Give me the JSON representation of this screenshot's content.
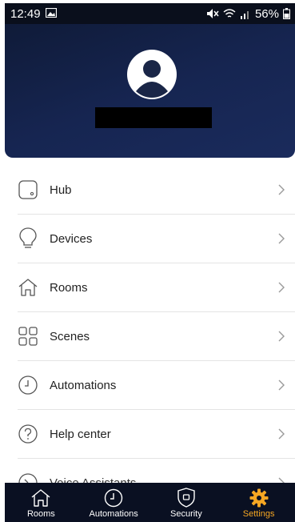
{
  "status_bar": {
    "time": "12:49",
    "battery": "56%"
  },
  "menu": {
    "items": [
      {
        "label": "Hub",
        "icon": "hub-icon"
      },
      {
        "label": "Devices",
        "icon": "lightbulb-icon"
      },
      {
        "label": "Rooms",
        "icon": "house-icon"
      },
      {
        "label": "Scenes",
        "icon": "scenes-grid-icon"
      },
      {
        "label": "Automations",
        "icon": "clock-icon"
      },
      {
        "label": "Help center",
        "icon": "question-icon"
      },
      {
        "label": "Voice Assistants",
        "icon": "voice-icon"
      }
    ]
  },
  "bottom_nav": {
    "items": [
      {
        "label": "Rooms",
        "icon": "house-icon"
      },
      {
        "label": "Automations",
        "icon": "clock-icon"
      },
      {
        "label": "Security",
        "icon": "shield-icon"
      },
      {
        "label": "Settings",
        "icon": "gear-icon",
        "active": true
      }
    ]
  },
  "colors": {
    "header": "#162551",
    "nav_background": "#0a1022",
    "accent": "#f5a623"
  }
}
